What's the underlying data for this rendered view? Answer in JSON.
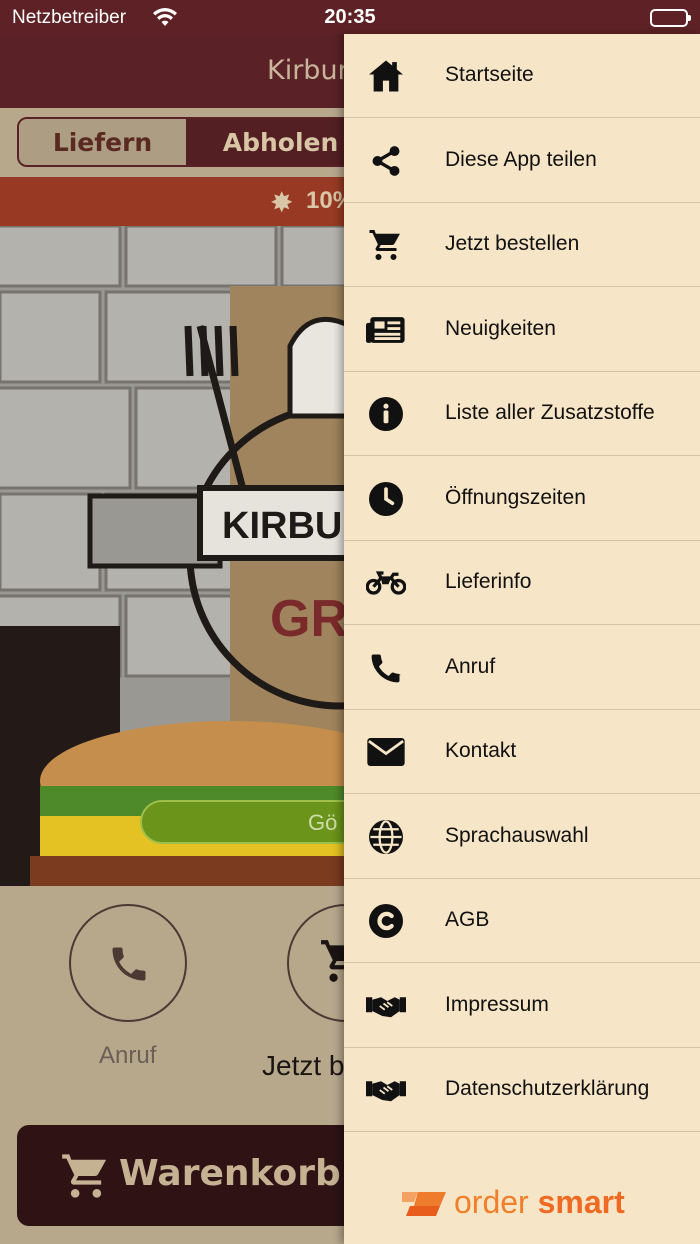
{
  "status_bar": {
    "carrier": "Netzbetreiber",
    "time": "20:35",
    "icons": [
      "wifi-icon",
      "battery-icon"
    ]
  },
  "background_app": {
    "header_title": "Kirburg",
    "delivery_toggle": {
      "options": [
        "Liefern",
        "Abholen"
      ],
      "selected": "Abholen"
    },
    "promo_text": "10%",
    "status_pill": "Gö",
    "hero_logo_text": {
      "top": "KIRBU",
      "bottom": "GR"
    },
    "actions": {
      "call_label": "Anruf",
      "order_label": "Jetzt b"
    },
    "cart_button": "Warenkorb"
  },
  "drawer": {
    "items": [
      {
        "label": "Startseite",
        "icon": "home-icon"
      },
      {
        "label": "Diese App teilen",
        "icon": "share-icon"
      },
      {
        "label": "Jetzt bestellen",
        "icon": "cart-icon"
      },
      {
        "label": "Neuigkeiten",
        "icon": "newspaper-icon"
      },
      {
        "label": "Liste aller Zusatzstoffe",
        "icon": "info-icon"
      },
      {
        "label": "Öffnungszeiten",
        "icon": "clock-icon"
      },
      {
        "label": "Lieferinfo",
        "icon": "motorcycle-icon"
      },
      {
        "label": "Anruf",
        "icon": "phone-icon"
      },
      {
        "label": "Kontakt",
        "icon": "envelope-icon"
      },
      {
        "label": "Sprachauswahl",
        "icon": "globe-icon"
      },
      {
        "label": "AGB",
        "icon": "copyright-icon"
      },
      {
        "label": "Impressum",
        "icon": "handshake-icon"
      },
      {
        "label": "Datenschutzerklärung",
        "icon": "handshake-icon"
      }
    ],
    "brand": {
      "part1": "order",
      "part2": "smart"
    }
  },
  "colors": {
    "header": "#5a2226",
    "drawer_bg": "#f6e5c6",
    "promo": "#983a23",
    "accent_orange": "#f07f2a"
  }
}
